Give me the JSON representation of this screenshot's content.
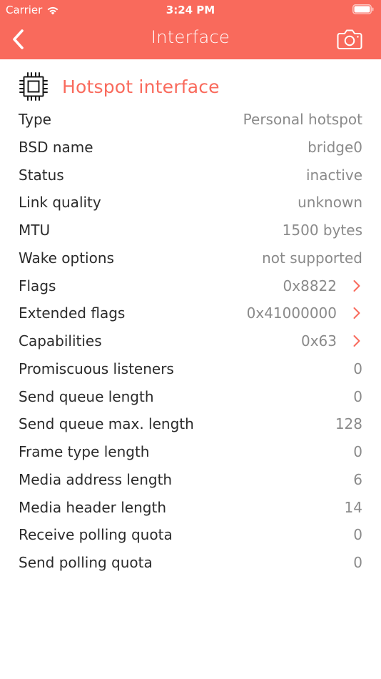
{
  "status_bar": {
    "carrier": "Carrier",
    "time": "3:24 PM"
  },
  "nav": {
    "title": "Interface",
    "back_icon": "chevron-left-icon",
    "action_icon": "camera-icon"
  },
  "section": {
    "icon": "chip-icon",
    "title": "Hotspot interface"
  },
  "colors": {
    "accent": "#f96a5c",
    "label": "#2b2b2b",
    "value": "#8a8a8a"
  },
  "rows": [
    {
      "label": "Type",
      "value": "Personal hotspot",
      "link": false
    },
    {
      "label": "BSD name",
      "value": "bridge0",
      "link": false
    },
    {
      "label": "Status",
      "value": "inactive",
      "link": false
    },
    {
      "label": "Link quality",
      "value": "unknown",
      "link": false
    },
    {
      "label": "MTU",
      "value": "1500 bytes",
      "link": false
    },
    {
      "label": "Wake options",
      "value": "not supported",
      "link": false
    },
    {
      "label": "Flags",
      "value": "0x8822",
      "link": true
    },
    {
      "label": "Extended flags",
      "value": "0x41000000",
      "link": true
    },
    {
      "label": "Capabilities",
      "value": "0x63",
      "link": true
    },
    {
      "label": "Promiscuous listeners",
      "value": "0",
      "link": false
    },
    {
      "label": "Send queue length",
      "value": "0",
      "link": false
    },
    {
      "label": "Send queue max. length",
      "value": "128",
      "link": false
    },
    {
      "label": "Frame type length",
      "value": "0",
      "link": false
    },
    {
      "label": "Media address length",
      "value": "6",
      "link": false
    },
    {
      "label": "Media header length",
      "value": "14",
      "link": false
    },
    {
      "label": "Receive polling quota",
      "value": "0",
      "link": false
    },
    {
      "label": "Send polling quota",
      "value": "0",
      "link": false
    }
  ]
}
